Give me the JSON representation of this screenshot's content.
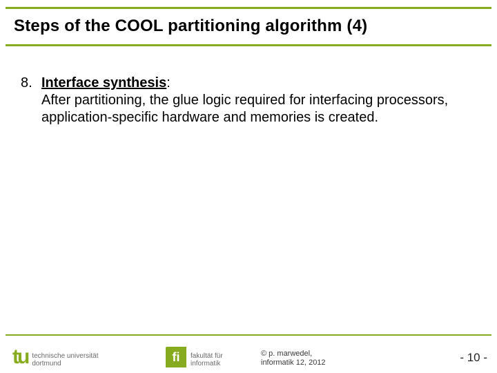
{
  "title": "Steps of the COOL partitioning algorithm (4)",
  "item": {
    "number": "8.",
    "heading": "Interface synthesis",
    "body": "After partitioning, the glue logic required for interfacing processors, application-specific hardware and memories is created."
  },
  "footer": {
    "tu_label1": "technische universität",
    "tu_label2": "dortmund",
    "tu_glyph": "tu",
    "fi_glyph": "fi",
    "fi_label1": "fakultät für",
    "fi_label2": "informatik",
    "credit_sym": "©",
    "credit_line1": "p. marwedel,",
    "credit_line2": "informatik 12,  2012",
    "pagenum": "-  10 -"
  }
}
